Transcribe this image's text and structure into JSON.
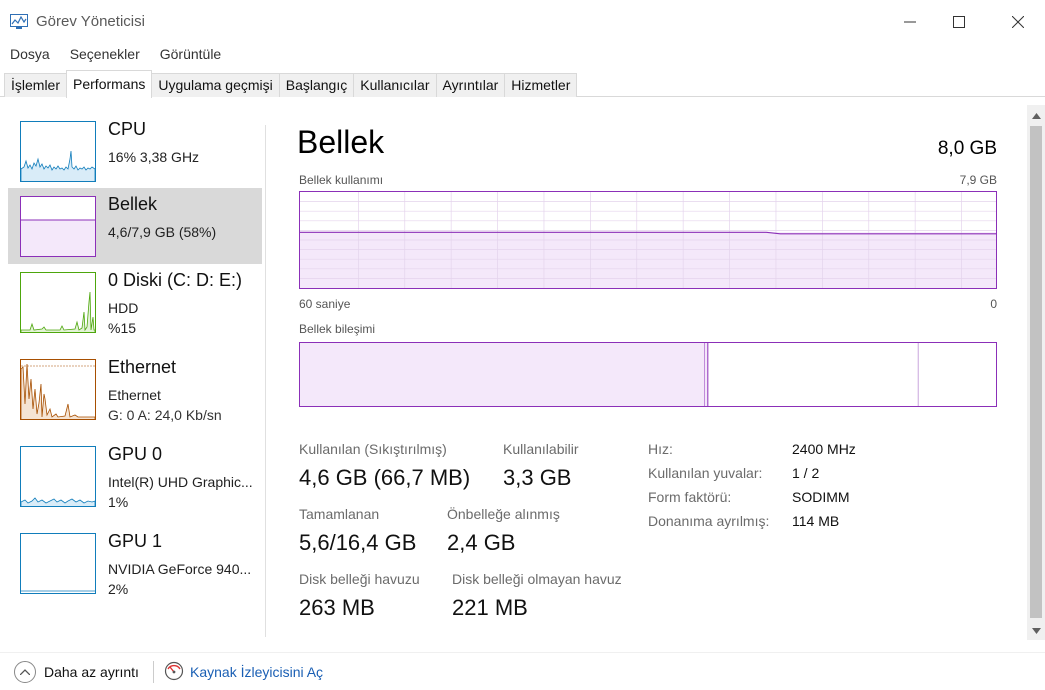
{
  "window": {
    "title": "Görev Yöneticisi"
  },
  "menu": [
    "Dosya",
    "Seçenekler",
    "Görüntüle"
  ],
  "tabs": [
    "İşlemler",
    "Performans",
    "Uygulama geçmişi",
    "Başlangıç",
    "Kullanıcılar",
    "Ayrıntılar",
    "Hizmetler"
  ],
  "active_tab": "Performans",
  "sidebar": [
    {
      "title": "CPU",
      "line1": "16%  3,38 GHz",
      "line2": "",
      "color": "#117dbb"
    },
    {
      "title": "Bellek",
      "line1": "4,6/7,9 GB (58%)",
      "line2": "",
      "color": "#8b2fb8"
    },
    {
      "title": "0 Diski (C: D: E:)",
      "line1": "HDD",
      "line2": "%15",
      "color": "#4da60c"
    },
    {
      "title": "Ethernet",
      "line1": "Ethernet",
      "line2": "G: 0 A: 24,0 Kb/sn",
      "color": "#a74f01"
    },
    {
      "title": "GPU 0",
      "line1": "Intel(R) UHD Graphic...",
      "line2": "1%",
      "color": "#117dbb"
    },
    {
      "title": "GPU 1",
      "line1": "NVIDIA GeForce 940...",
      "line2": "2%",
      "color": "#117dbb"
    }
  ],
  "main": {
    "title": "Bellek",
    "total": "8,0 GB",
    "usage_label": "Bellek kullanımı",
    "usage_max": "7,9 GB",
    "time_left": "60 saniye",
    "time_right": "0",
    "composition_label": "Bellek bileşimi",
    "usage_fraction": 0.58
  },
  "stats": {
    "in_use_label": "Kullanılan (Sıkıştırılmış)",
    "in_use_value": "4,6 GB (66,7 MB)",
    "available_label": "Kullanılabilir",
    "available_value": "3,3 GB",
    "committed_label": "Tamamlanan",
    "committed_value": "5,6/16,4 GB",
    "cached_label": "Önbelleğe alınmış",
    "cached_value": "2,4 GB",
    "paged_label": "Disk belleği havuzu",
    "paged_value": "263 MB",
    "nonpaged_label": "Disk belleği olmayan havuz",
    "nonpaged_value": "221 MB"
  },
  "details": [
    {
      "key": "Hız:",
      "value": "2400 MHz"
    },
    {
      "key": "Kullanılan yuvalar:",
      "value": "1 / 2"
    },
    {
      "key": "Form faktörü:",
      "value": "SODIMM"
    },
    {
      "key": "Donanıma ayrılmış:",
      "value": "114 MB"
    }
  ],
  "footer": {
    "fewer_details": "Daha az ayrıntı",
    "resource_monitor": "Kaynak İzleyicisini Aç"
  },
  "colors": {
    "memory": "#8b2fb8",
    "cpu": "#117dbb",
    "disk": "#4da60c",
    "ethernet": "#a74f01",
    "selected": "#d9d9d9"
  }
}
